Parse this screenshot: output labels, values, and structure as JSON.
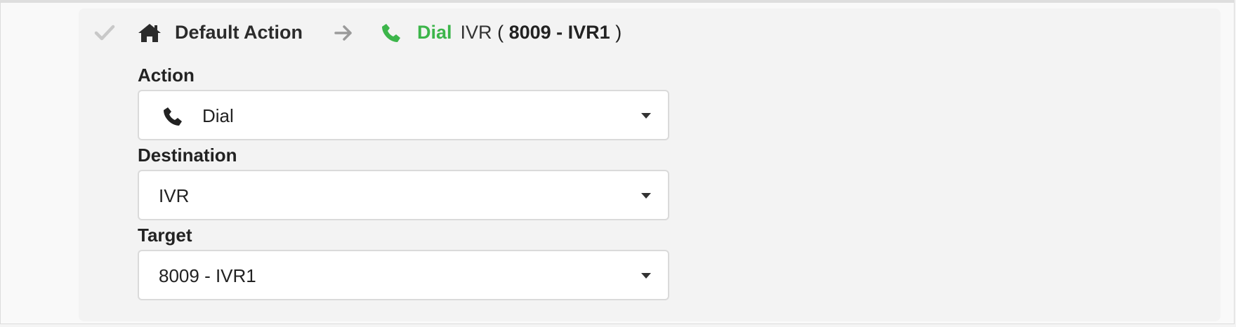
{
  "header": {
    "title": "Default Action",
    "summary_action": "Dial",
    "summary_destination": "IVR",
    "summary_open_paren": "(",
    "summary_target": "8009 - IVR1",
    "summary_close_paren": ")"
  },
  "fields": {
    "action": {
      "label": "Action",
      "value": "Dial",
      "icon": "phone-icon"
    },
    "destination": {
      "label": "Destination",
      "value": "IVR"
    },
    "target": {
      "label": "Target",
      "value": "8009 - IVR1"
    }
  },
  "colors": {
    "accent_green": "#3cb54a",
    "check_gray": "#c8c8c8",
    "arrow_gray": "#9a9a9a"
  },
  "icons": [
    "check-icon",
    "home-icon",
    "arrow-right-icon",
    "phone-icon",
    "chevron-down-icon"
  ]
}
